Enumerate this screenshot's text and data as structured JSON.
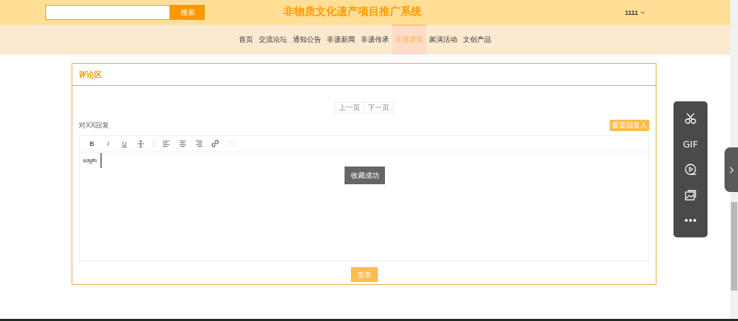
{
  "header": {
    "search_button": "搜索",
    "title": "非物质文化遗产项目推广系统",
    "user": "1111"
  },
  "nav": [
    {
      "label": "首页",
      "selected": false
    },
    {
      "label": "交流论坛",
      "selected": false
    },
    {
      "label": "通知公告",
      "selected": false
    },
    {
      "label": "非遗新闻",
      "selected": false
    },
    {
      "label": "非遗传承",
      "selected": false
    },
    {
      "label": "非遗课堂",
      "selected": true
    },
    {
      "label": "展演活动",
      "selected": false
    },
    {
      "label": "文创产品",
      "selected": false
    }
  ],
  "comments": {
    "title": "评论区",
    "pager": [
      "上一页",
      "下一页"
    ],
    "reply_to": "对XX回复",
    "reset_button": "重置回复人",
    "toolbar": [
      {
        "kind": "bold",
        "label": "B",
        "disabled": false
      },
      {
        "kind": "italic",
        "label": "I",
        "disabled": false
      },
      {
        "kind": "underline",
        "label": "U",
        "disabled": false
      },
      {
        "kind": "strike",
        "disabled": false
      },
      {
        "kind": "divider"
      },
      {
        "kind": "align-left",
        "disabled": false
      },
      {
        "kind": "align-center",
        "disabled": false
      },
      {
        "kind": "align-right",
        "disabled": false
      },
      {
        "kind": "link",
        "disabled": false
      },
      {
        "kind": "unlink",
        "disabled": true
      }
    ],
    "editor_text": "sdgfh",
    "toast": "收藏成功",
    "submit": "发表"
  },
  "capture_toolbar": [
    {
      "kind": "scissors"
    },
    {
      "kind": "text",
      "label": "GIF"
    },
    {
      "kind": "record"
    },
    {
      "kind": "image"
    },
    {
      "kind": "more"
    }
  ]
}
